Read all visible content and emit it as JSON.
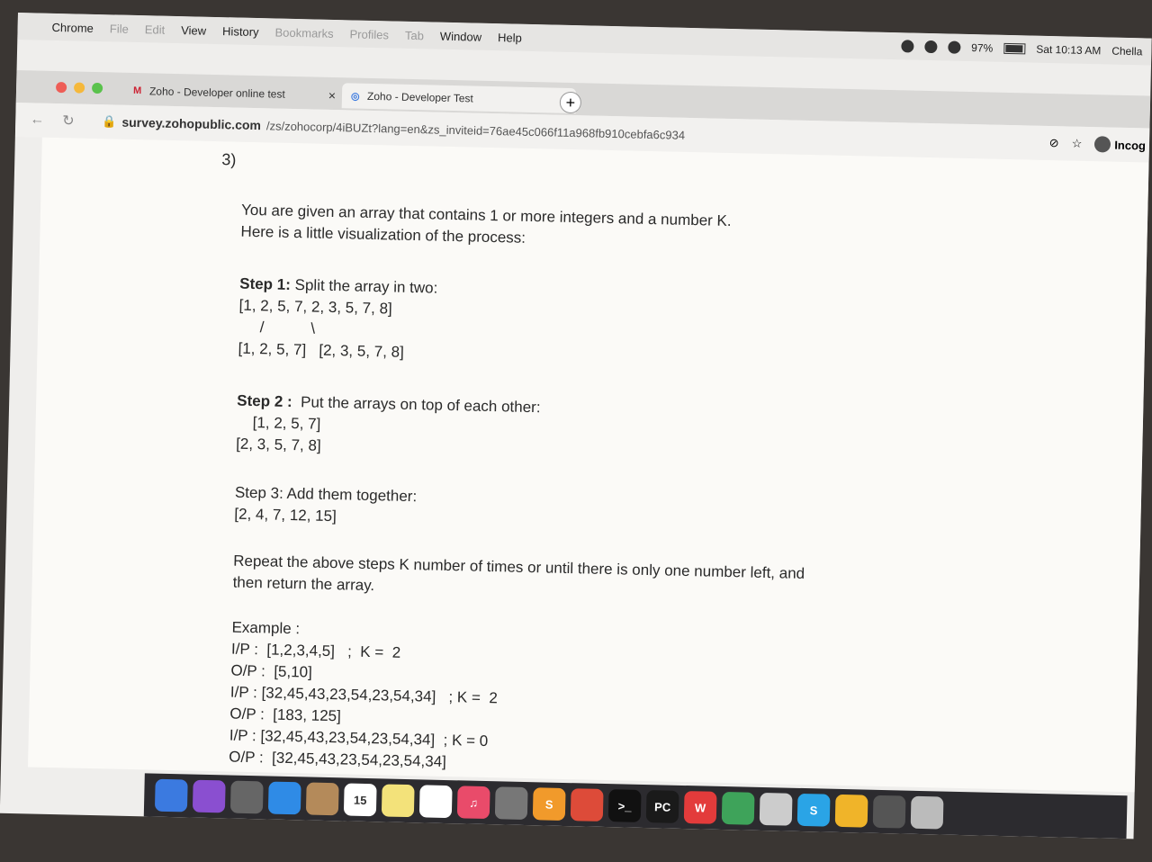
{
  "menubar": {
    "apple_icon": "apple-icon",
    "items": [
      {
        "label": "Chrome",
        "dim": false
      },
      {
        "label": "File",
        "dim": true
      },
      {
        "label": "Edit",
        "dim": true
      },
      {
        "label": "View",
        "dim": false
      },
      {
        "label": "History",
        "dim": false
      },
      {
        "label": "Bookmarks",
        "dim": true
      },
      {
        "label": "Profiles",
        "dim": true
      },
      {
        "label": "Tab",
        "dim": true
      },
      {
        "label": "Window",
        "dim": false
      },
      {
        "label": "Help",
        "dim": false
      }
    ],
    "battery": "97%",
    "battery_level": 0.97,
    "clock": "Sat 10:13 AM",
    "user": "Chella"
  },
  "tabs": [
    {
      "icon": "gmail-icon",
      "icon_glyph": "M",
      "label": "Zoho - Developer online test",
      "close": "×"
    },
    {
      "icon": "zoho-icon",
      "icon_glyph": "◎",
      "label": "Zoho - Developer Test",
      "close": "×"
    }
  ],
  "newtab_label": "+",
  "address": {
    "domain": "survey.zohopublic.com",
    "path": "/zs/zohocorp/4iBUZt?lang=en&zs_inviteid=76ae45c066f11a968fb910cebfa6c934",
    "incognito": "Incog"
  },
  "question": {
    "number": "3)",
    "intro1": "You are given an array that contains 1 or more integers and a number K.",
    "intro2": "Here is a little visualization of the process:",
    "step1_label": "Step 1:",
    "step1_text": " Split the array in two:",
    "step1_array": "[1, 2, 5, 7, 2, 3, 5, 7, 8]",
    "step1_slashes": "     /           \\",
    "step1_split": "[1, 2, 5, 7]   [2, 3, 5, 7, 8]",
    "step2_label": "Step 2 :",
    "step2_text": "  Put the arrays on top of each other:",
    "step2_row1": "[1, 2, 5, 7]",
    "step2_row2": "[2, 3, 5, 7, 8]",
    "step3_text": "Step 3: Add them together:",
    "step3_result": "[2, 4, 7, 12, 15]",
    "repeat1": "Repeat the above steps K number of times or until there is only one number left, and",
    "repeat2": "then return the array.",
    "example_label": "Example :",
    "examples": [
      "I/P :  [1,2,3,4,5]   ;  K =  2",
      "O/P :  [5,10]",
      "I/P : [32,45,43,23,54,23,54,34]   ; K =  2",
      "O/P :  [183, 125]",
      "I/P : [32,45,43,23,54,23,54,34]  ; K = 0",
      "O/P :  [32,45,43,23,54,23,54,34]"
    ]
  },
  "dock": [
    {
      "name": "finder-icon",
      "color": "#3b7ae0",
      "glyph": ""
    },
    {
      "name": "siri-icon",
      "color": "#8a4fd0",
      "glyph": ""
    },
    {
      "name": "launchpad-icon",
      "color": "#666666",
      "glyph": ""
    },
    {
      "name": "safari-icon",
      "color": "#2f8be6",
      "glyph": ""
    },
    {
      "name": "contacts-icon",
      "color": "#b48a5a",
      "glyph": ""
    },
    {
      "name": "calendar-icon",
      "color": "#ffffff",
      "glyph": "15"
    },
    {
      "name": "notes-icon",
      "color": "#f3e27a",
      "glyph": ""
    },
    {
      "name": "reminders-icon",
      "color": "#ffffff",
      "glyph": ""
    },
    {
      "name": "music-icon",
      "color": "#e94b6a",
      "glyph": "♫"
    },
    {
      "name": "photos-icon",
      "color": "#777777",
      "glyph": ""
    },
    {
      "name": "sublime-icon",
      "color": "#f19a2b",
      "glyph": "S"
    },
    {
      "name": "chrome-icon",
      "color": "#dd4b39",
      "glyph": ""
    },
    {
      "name": "terminal-icon",
      "color": "#111111",
      "glyph": ">_"
    },
    {
      "name": "pycharm-icon",
      "color": "#1a1a1a",
      "glyph": "PC"
    },
    {
      "name": "wps-icon",
      "color": "#e33b3b",
      "glyph": "W"
    },
    {
      "name": "circle-app-icon",
      "color": "#3ea35a",
      "glyph": ""
    },
    {
      "name": "preview-icon",
      "color": "#cccccc",
      "glyph": ""
    },
    {
      "name": "skype-icon",
      "color": "#2aa4e6",
      "glyph": "S"
    },
    {
      "name": "folder-icon",
      "color": "#f0b429",
      "glyph": ""
    },
    {
      "name": "window-thumb-icon",
      "color": "#555555",
      "glyph": ""
    },
    {
      "name": "trash-icon",
      "color": "#bbbbbb",
      "glyph": ""
    }
  ]
}
